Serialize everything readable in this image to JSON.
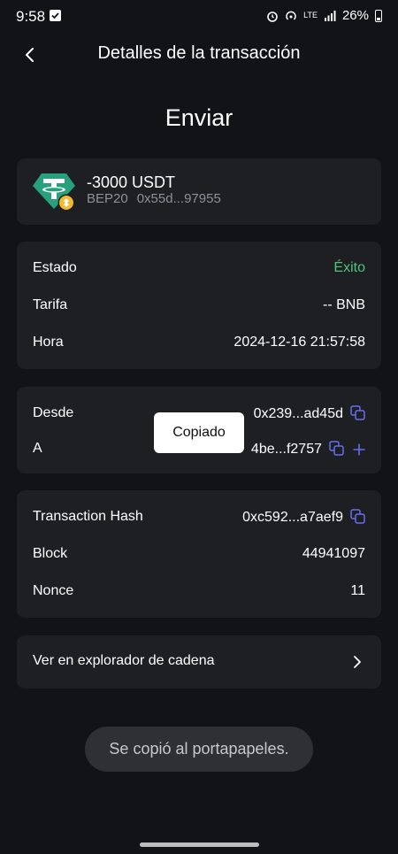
{
  "status_bar": {
    "time": "9:58",
    "battery": "26%",
    "network": "LTE"
  },
  "header": {
    "title": "Detalles de la transacción"
  },
  "main": {
    "title": "Enviar",
    "token": {
      "amount": "-3000 USDT",
      "network": "BEP20",
      "address": "0x55d...97955"
    },
    "details": [
      {
        "label": "Estado",
        "value": "Éxito"
      },
      {
        "label": "Tarifa",
        "value": "-- BNB"
      },
      {
        "label": "Hora",
        "value": "2024-12-16 21:57:58"
      }
    ],
    "parties": {
      "from": {
        "label": "Desde",
        "value": "0x239...ad45d"
      },
      "to": {
        "label": "A",
        "value": "4be...f2757"
      }
    },
    "tx": [
      {
        "label": "Transaction Hash",
        "value": "0xc592...a7aef9"
      },
      {
        "label": "Block",
        "value": "44941097"
      },
      {
        "label": "Nonce",
        "value": "11"
      }
    ],
    "explorer_label": "Ver en explorador de cadena"
  },
  "tooltip": "Copiado",
  "toast": "Se copió al portapapeles.",
  "colors": {
    "background": "#121316",
    "card": "#1e1f23",
    "success": "#4cc67a",
    "accent": "#6a6cf0",
    "tether": "#26a17b",
    "bnb": "#f3ba2f"
  },
  "icons": [
    "back-arrow-icon",
    "copy-icon",
    "plus-icon",
    "chevron-right-icon",
    "tether-icon",
    "bnb-badge-icon"
  ]
}
